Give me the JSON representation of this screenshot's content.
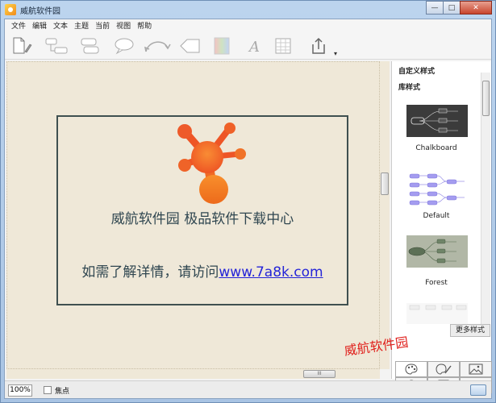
{
  "window": {
    "title": "威航软件园",
    "buttons": {
      "minimize": "—",
      "maximize": "□",
      "close": "✕"
    }
  },
  "menu": [
    "文件",
    "编辑",
    "文本",
    "主题",
    "当前",
    "视图",
    "帮助"
  ],
  "toolbar": {
    "icons": [
      "new-document-icon",
      "callout-icon",
      "subtopic-icon",
      "floating-topic-icon",
      "speech-bubble-icon",
      "relationship-icon",
      "boundary-icon",
      "gradient-icon",
      "font-icon",
      "table-icon",
      "share-icon"
    ],
    "more": "▾"
  },
  "canvas": {
    "slogan_main": "威航软件园 极品软件下载中心",
    "slogan_prefix": "如需了解详情，请访问",
    "slogan_link": "www.7a8k.com",
    "hscroll_grip": "III"
  },
  "right_panel": {
    "custom_styles_label": "自定义样式",
    "library_label": "库样式",
    "styles": [
      {
        "name": "Chalkboard"
      },
      {
        "name": "Default"
      },
      {
        "name": "Forest"
      }
    ],
    "more_button": "更多样式",
    "watermark": "威航软件园"
  },
  "statusbar": {
    "zoom": "100%",
    "focus_label": "焦点"
  },
  "colors": {
    "canvas_bg": "#efe8d8",
    "topic_border": "#3f5050",
    "link": "#2424d8",
    "logo_orange": "#f26a2c",
    "watermark_red": "#e0201c"
  }
}
